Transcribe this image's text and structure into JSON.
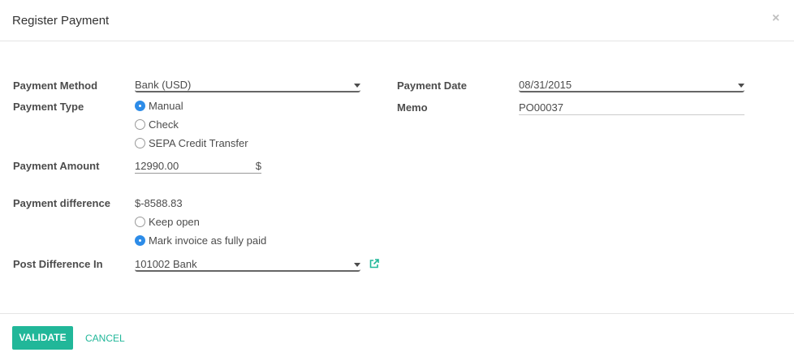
{
  "dialog": {
    "title": "Register Payment",
    "close_label": "×"
  },
  "labels": {
    "payment_method": "Payment Method",
    "payment_type": "Payment Type",
    "payment_amount": "Payment Amount",
    "payment_difference": "Payment difference",
    "post_difference_in": "Post Difference In",
    "payment_date": "Payment Date",
    "memo": "Memo"
  },
  "values": {
    "payment_method": "Bank (USD)",
    "payment_amount": "12990.00",
    "currency_symbol": "$",
    "payment_difference": "$-8588.83",
    "post_difference_in": "101002 Bank",
    "payment_date": "08/31/2015",
    "memo": "PO00037"
  },
  "payment_type_options": [
    {
      "label": "Manual",
      "checked": true
    },
    {
      "label": "Check",
      "checked": false
    },
    {
      "label": "SEPA Credit Transfer",
      "checked": false
    }
  ],
  "difference_options": [
    {
      "label": "Keep open",
      "checked": false
    },
    {
      "label": "Mark invoice as fully paid",
      "checked": true
    }
  ],
  "footer": {
    "validate_label": "VALIDATE",
    "cancel_label": "CANCEL"
  },
  "colors": {
    "accent": "#21b799",
    "radio_checked": "#2d8ce8"
  },
  "icons": {
    "external_link": "external-link-icon",
    "close": "close-icon",
    "dropdown": "caret-down-icon"
  }
}
